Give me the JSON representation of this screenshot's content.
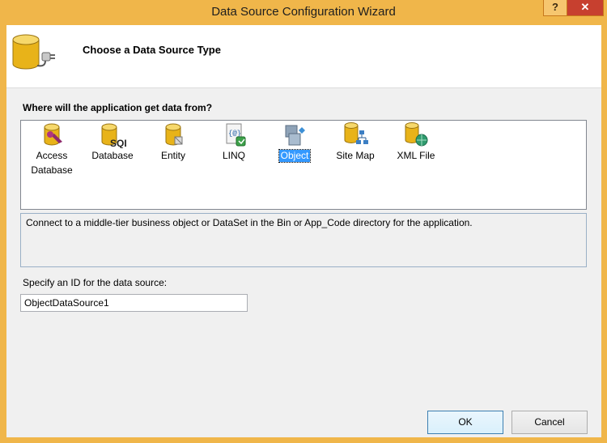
{
  "window": {
    "title": "Data Source Configuration Wizard"
  },
  "titlebar_buttons": {
    "help": "?",
    "close": "✕"
  },
  "header": {
    "title": "Choose a Data Source Type"
  },
  "question": "Where will the application get data from?",
  "types": [
    {
      "label_line1": "Access",
      "label_line2": "Database",
      "icon": "access-database-icon"
    },
    {
      "label_line1": "Database",
      "label_line2": "",
      "icon": "sql-database-icon"
    },
    {
      "label_line1": "Entity",
      "label_line2": "",
      "icon": "entity-icon"
    },
    {
      "label_line1": "LINQ",
      "label_line2": "",
      "icon": "linq-icon"
    },
    {
      "label_line1": "Object",
      "label_line2": "",
      "icon": "object-icon",
      "selected": true
    },
    {
      "label_line1": "Site Map",
      "label_line2": "",
      "icon": "site-map-icon"
    },
    {
      "label_line1": "XML File",
      "label_line2": "",
      "icon": "xml-file-icon"
    }
  ],
  "description": "Connect to a middle-tier business object or DataSet in the Bin or App_Code directory for the application.",
  "id_field": {
    "label": "Specify an ID for the data source:",
    "value": "ObjectDataSource1"
  },
  "buttons": {
    "ok": "OK",
    "cancel": "Cancel"
  },
  "colors": {
    "frame": "#f0b64a",
    "close": "#c7402f",
    "selection": "#3399ff",
    "database_gold": "#e8b319"
  }
}
